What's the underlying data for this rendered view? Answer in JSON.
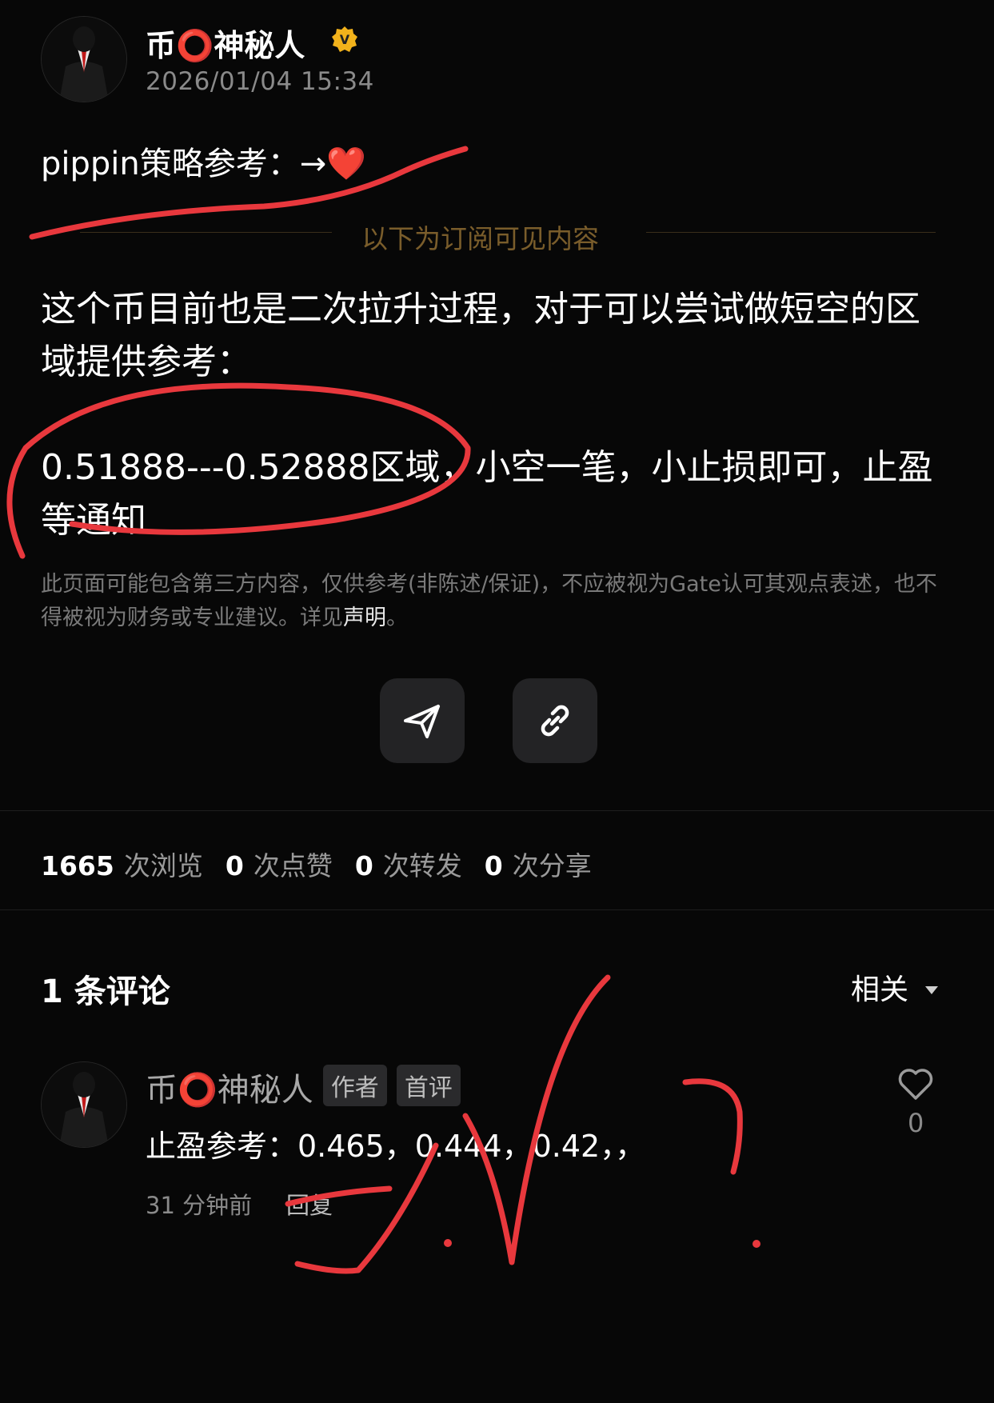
{
  "post": {
    "author": "币⭕神秘人",
    "verified_badge": "V",
    "timestamp": "2026/01/04 15:34",
    "title": "pippin策略参考：→❤️",
    "subscriber_divider": "以下为订阅可见内容",
    "body_line1": "这个币目前也是二次拉升过程，对于可以尝试做短空的区域提供参考：",
    "body_line2": "0.51888---0.52888区域，小空一笔，小止损即可，止盈等通知",
    "disclaimer_text": "此页面可能包含第三方内容，仅供参考(非陈述/保证)，不应被视为Gate认可其观点表述，也不得被视为财务或专业建议。详见",
    "disclaimer_link": "声明",
    "disclaimer_end": "。"
  },
  "actions": {
    "share_icon": "send-icon",
    "copy_link_icon": "link-icon"
  },
  "stats": [
    {
      "value": "1665",
      "label": "次浏览"
    },
    {
      "value": "0",
      "label": "次点赞"
    },
    {
      "value": "0",
      "label": "次转发"
    },
    {
      "value": "0",
      "label": "次分享"
    }
  ],
  "comments": {
    "title": "1 条评论",
    "sort_label": "相关",
    "items": [
      {
        "author": "币⭕神秘人",
        "tags": [
          "作者",
          "首评"
        ],
        "text": "止盈参考：0.465，0.444，0.42，，",
        "time": "31 分钟前",
        "reply_label": "回复",
        "likes": "0"
      }
    ]
  },
  "colors": {
    "background": "#070707",
    "verified_badge": "#f2b21b",
    "annotation_ink": "#e8383d",
    "subscriber_divider": "#7a5d2b"
  }
}
